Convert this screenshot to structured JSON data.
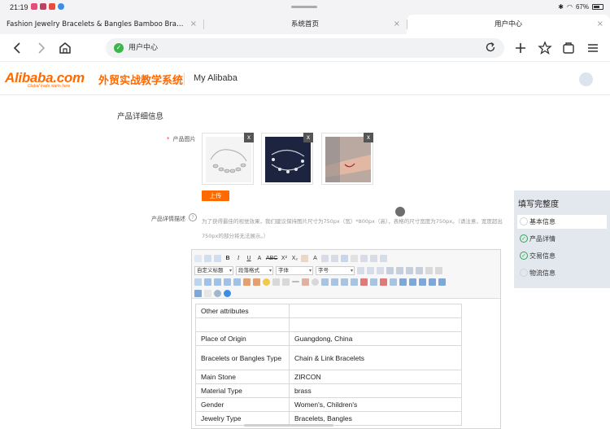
{
  "status_bar": {
    "time": "21:19",
    "battery": "67%"
  },
  "tabs": [
    {
      "label": "Fashion Jewelry Bracelets & Bangles Bamboo Bracelets …",
      "close": "×"
    },
    {
      "label": "系统首页",
      "close": "×"
    },
    {
      "label": "用户中心",
      "close": "×"
    }
  ],
  "toolbar": {
    "back_icon": "arrow-left",
    "forward_icon": "arrow-right",
    "home_icon": "home",
    "url": "用户中心",
    "reload_icon": "reload",
    "plus_icon": "plus",
    "star_icon": "star",
    "tabs_icon": "tabs",
    "menu_icon": "menu"
  },
  "site": {
    "logo_text": "Alibaba.com",
    "logo_slogan": "Global trade starts here",
    "logo_cn": "外贸实战教学系统",
    "nav_label": "My Alibaba"
  },
  "form": {
    "section_title": "产品详细信息",
    "images_label": "产品图片",
    "required_mark": "*",
    "remove_label": "x",
    "upload_label": "上传",
    "desc_label": "产品详情描述",
    "help_glyph": "?",
    "desc_hint": "为了获得最佳的视觉效果，我们建议保持图片尺寸为750px（宽）*800px（高），表格的尺寸宽度为750px。（请注意，宽度超出750px的部分将无法展示。）"
  },
  "editor": {
    "row1": [
      "B",
      "I",
      "U",
      "A",
      "ABC",
      "X²",
      "X₂",
      "A"
    ],
    "select_heading": "自定义标题",
    "select_paragraph": "段落格式",
    "select_font": "字体",
    "select_size": "字号"
  },
  "attributes": [
    {
      "name": "Other   attributes",
      "value": ""
    },
    {
      "name": "",
      "value": ""
    },
    {
      "name": "Place of   Origin",
      "value": "Guangdong, China"
    },
    {
      "name": "Bracelets or   Bangles Type",
      "value": "Chain & Link   Bracelets"
    },
    {
      "name": "Main Stone",
      "value": "ZIRCON"
    },
    {
      "name": "Material Type",
      "value": "brass"
    },
    {
      "name": "Gender",
      "value": "Women's, Children's"
    },
    {
      "name": "Jewelry Type",
      "value": "Bracelets, Bangles"
    }
  ],
  "completeness": {
    "title": "填写完整度",
    "check_glyph": "✓",
    "items": [
      {
        "label": "基本信息",
        "done": false,
        "active": true
      },
      {
        "label": "产品详情",
        "done": true,
        "active": false
      },
      {
        "label": "交易信息",
        "done": true,
        "active": false
      },
      {
        "label": "物流信息",
        "done": false,
        "active": false
      }
    ]
  },
  "colors": {
    "accent": "#ff6a00",
    "check": "#2fa84f",
    "shield": "#3cb64a"
  }
}
